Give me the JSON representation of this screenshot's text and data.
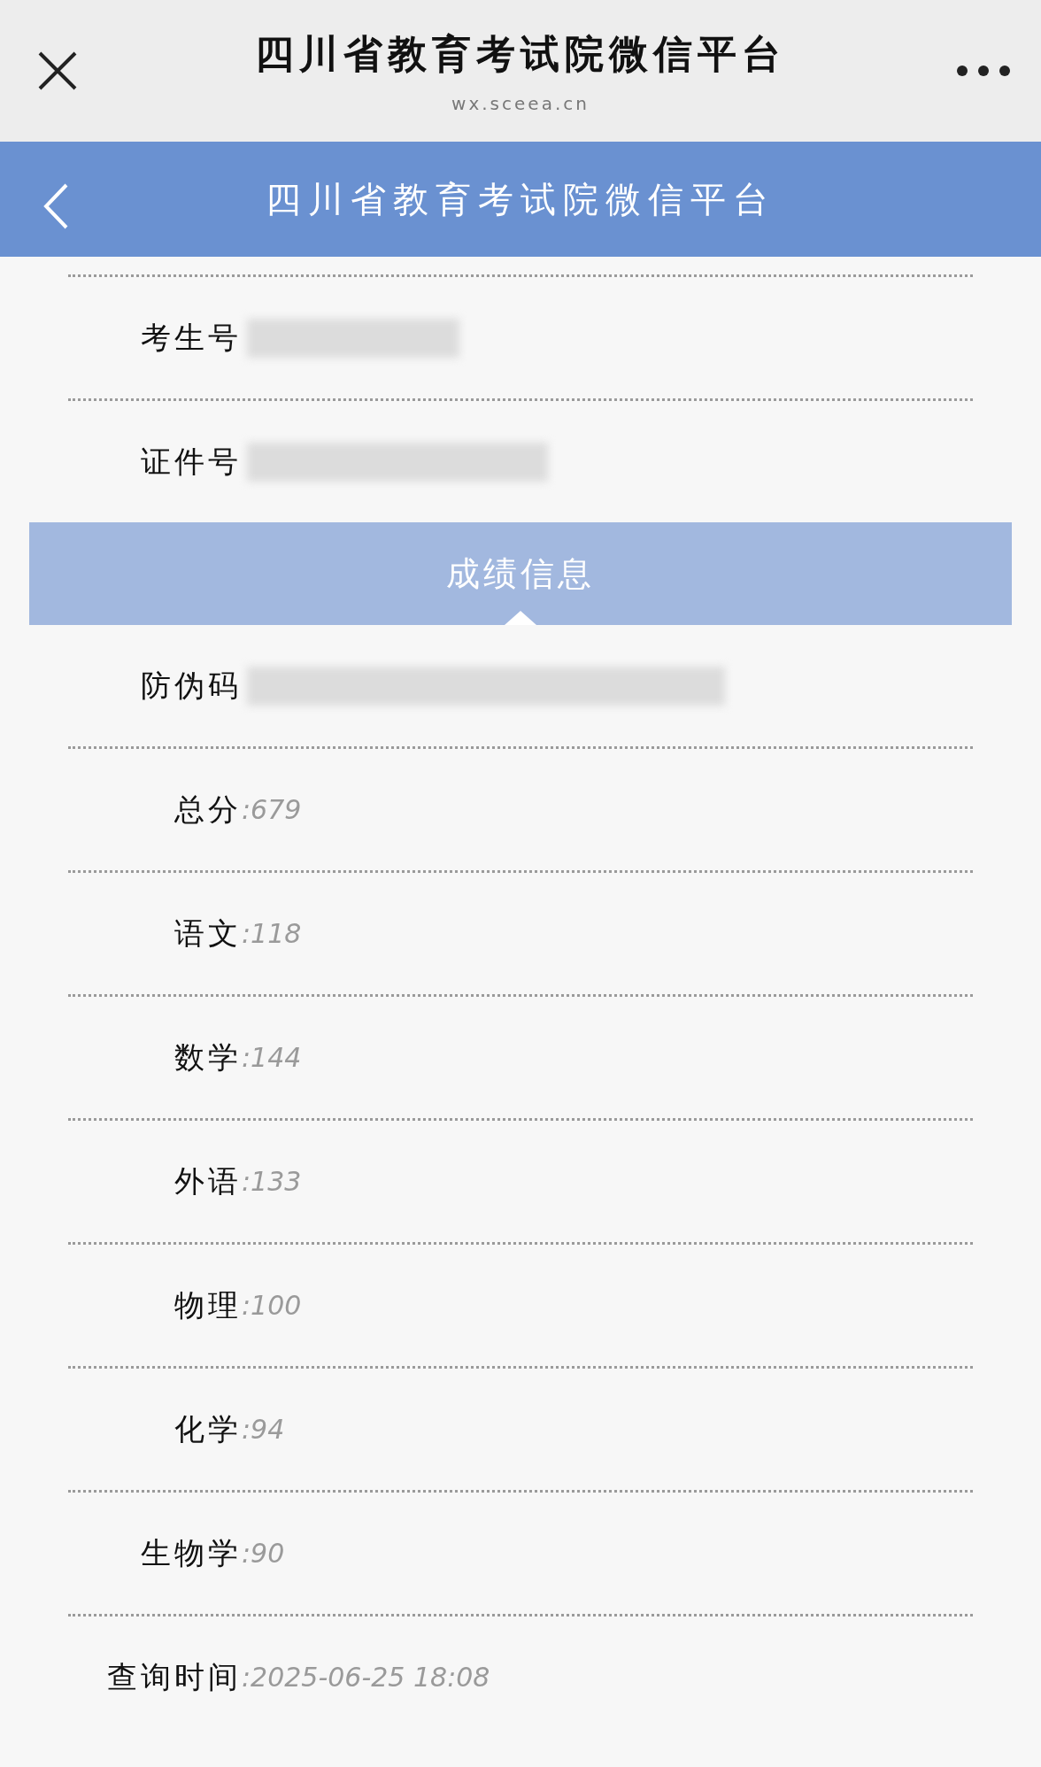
{
  "browser_bar": {
    "title": "四川省教育考试院微信平台",
    "url": "wx.sceea.cn"
  },
  "header": {
    "title": "四川省教育考试院微信平台"
  },
  "fields": [
    {
      "label": "考生号",
      "kind": "blurred"
    },
    {
      "label": "证件号",
      "kind": "blurred"
    }
  ],
  "section": {
    "title": "成绩信息"
  },
  "scores": [
    {
      "label": "防伪码",
      "kind": "blurred"
    },
    {
      "label": "总分",
      "kind": "text",
      "value": ":679"
    },
    {
      "label": "语文",
      "kind": "text",
      "value": ":118"
    },
    {
      "label": "数学",
      "kind": "text",
      "value": ":144"
    },
    {
      "label": "外语",
      "kind": "text",
      "value": ":133"
    },
    {
      "label": "物理",
      "kind": "text",
      "value": ":100"
    },
    {
      "label": "化学",
      "kind": "text",
      "value": ":94"
    },
    {
      "label": "生物学",
      "kind": "text",
      "value": ":90"
    },
    {
      "label": "查询时间",
      "kind": "text",
      "value": ":2025-06-25 18:08"
    }
  ]
}
